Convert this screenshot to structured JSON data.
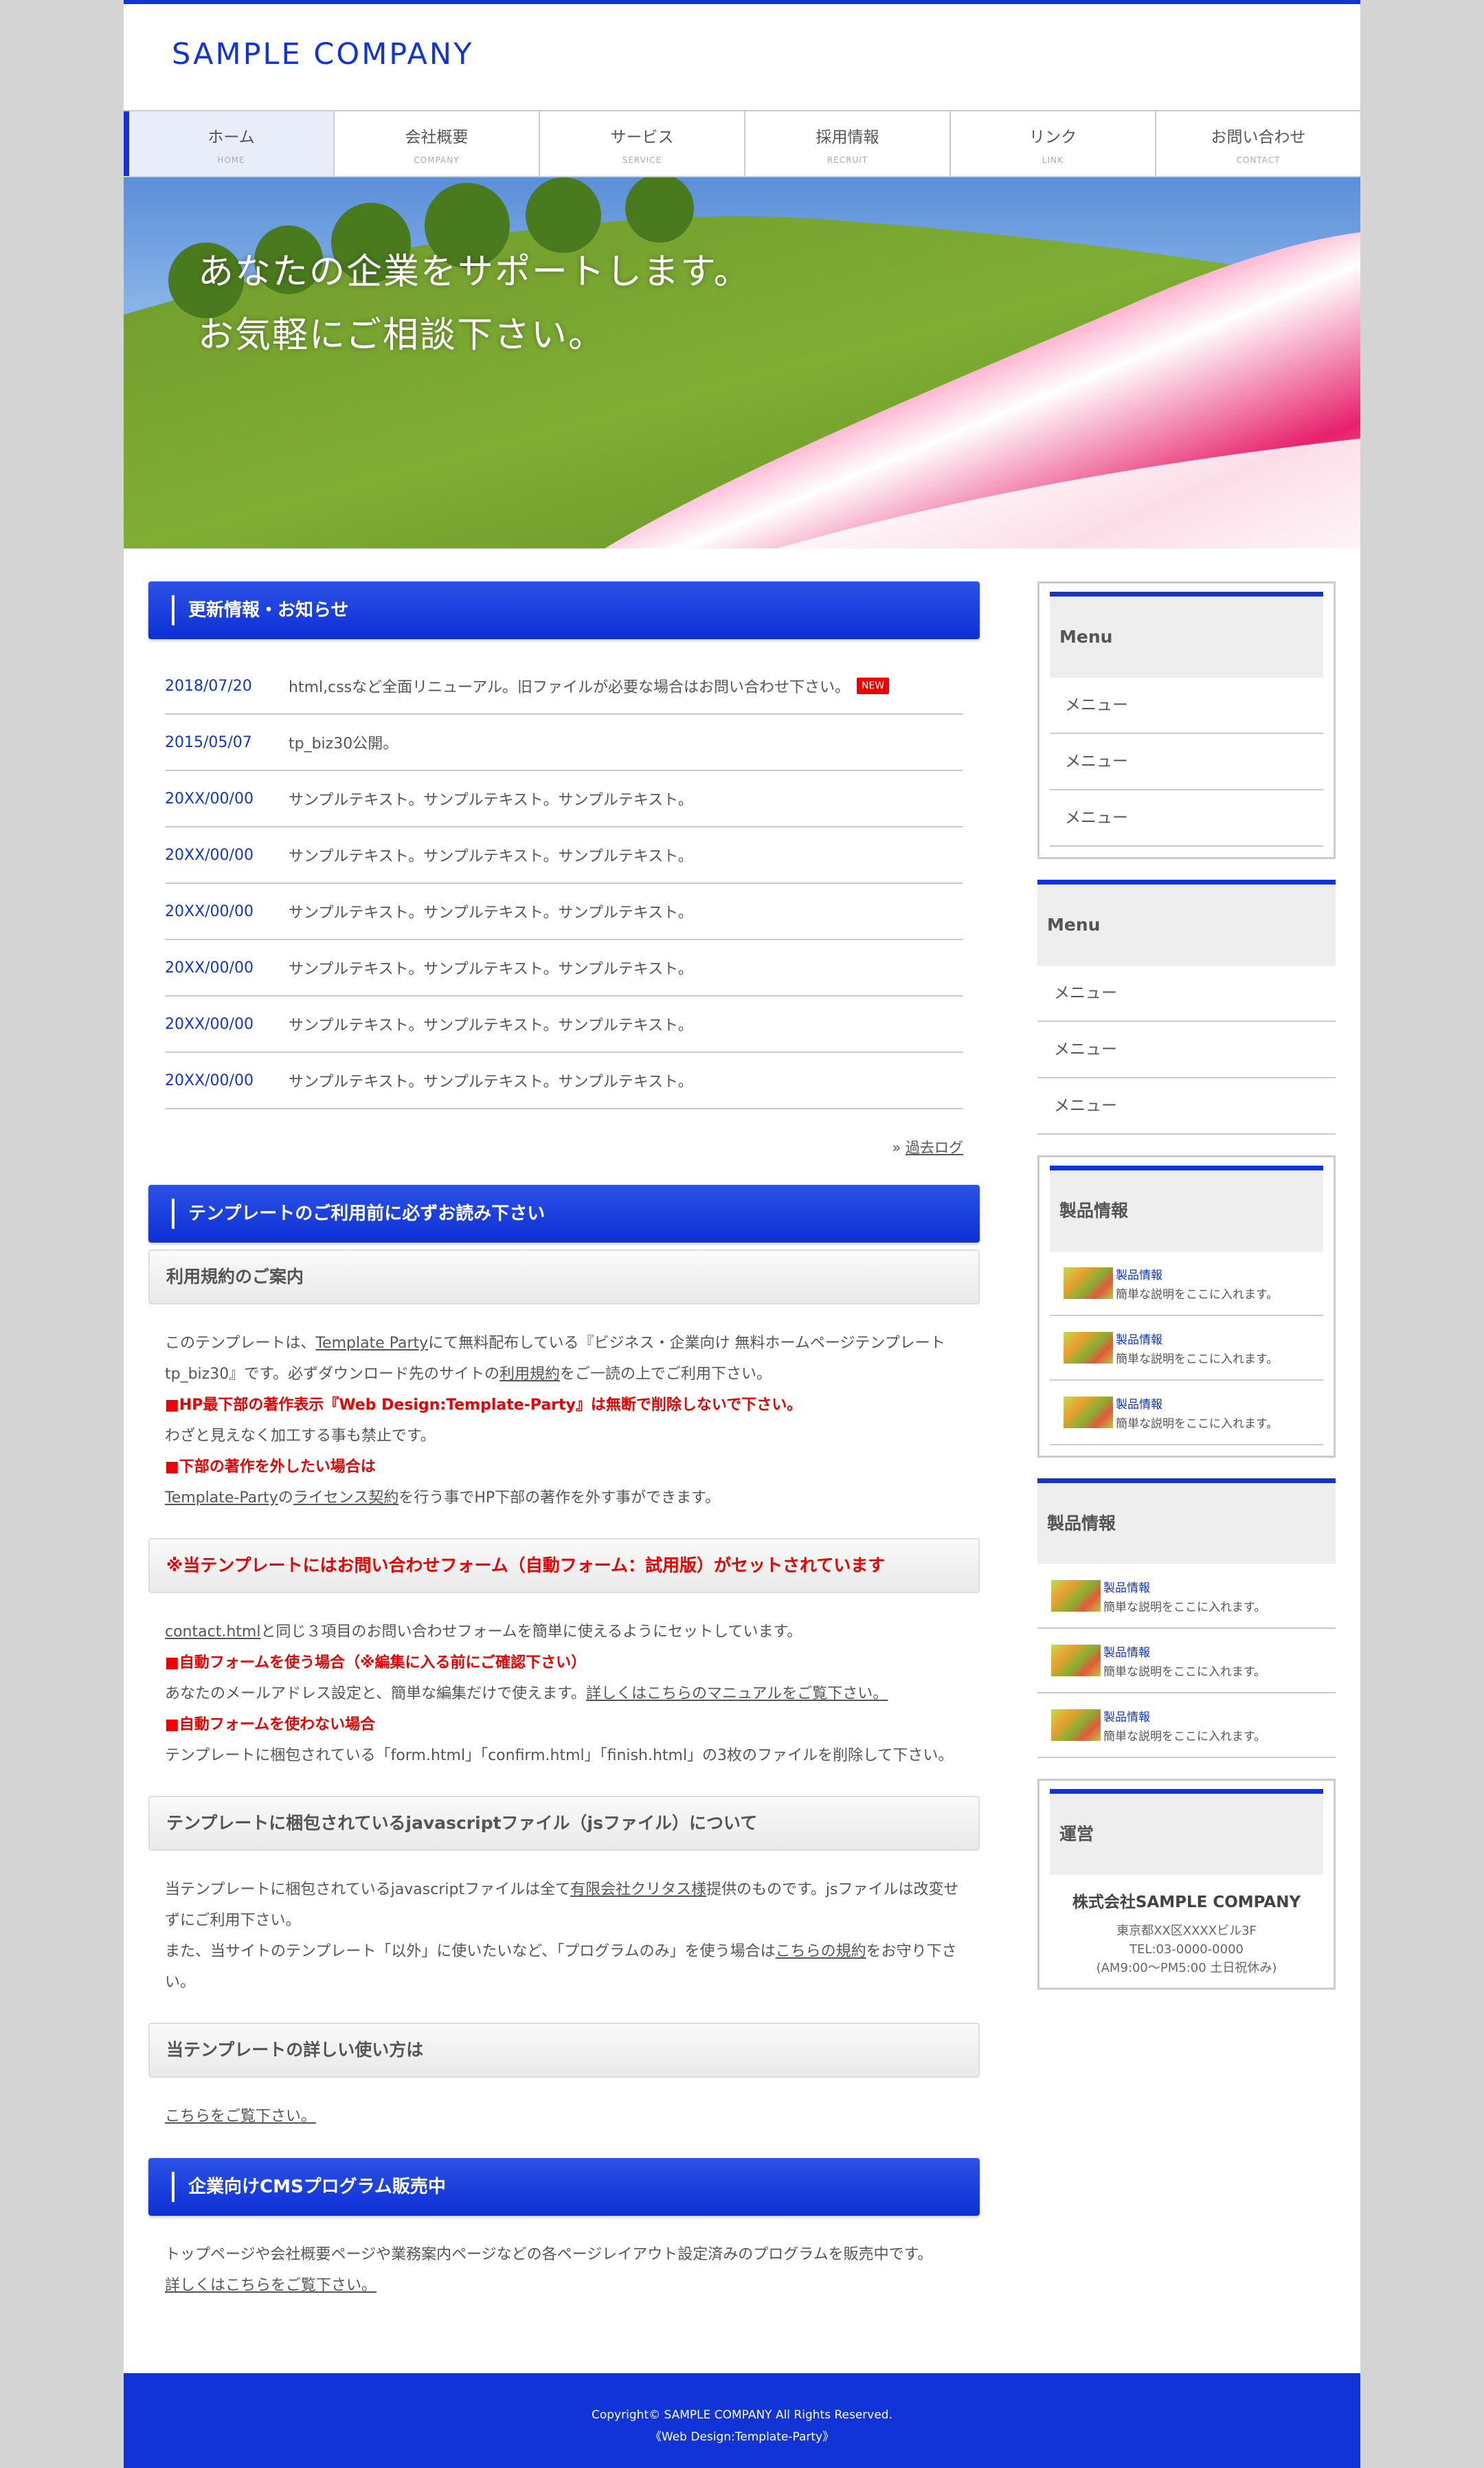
{
  "header": {
    "logo": "SAMPLE COMPANY"
  },
  "nav": [
    {
      "label": "ホーム",
      "sub": "HOME"
    },
    {
      "label": "会社概要",
      "sub": "COMPANY"
    },
    {
      "label": "サービス",
      "sub": "SERVICE"
    },
    {
      "label": "採用情報",
      "sub": "RECRUIT"
    },
    {
      "label": "リンク",
      "sub": "LINK"
    },
    {
      "label": "お問い合わせ",
      "sub": "CONTACT"
    }
  ],
  "hero": {
    "line1": "あなたの企業をサポートします。",
    "line2": "お気軽にご相談下さい。"
  },
  "news": {
    "heading": "更新情報・お知らせ",
    "new_badge": "NEW",
    "items": [
      {
        "date": "2018/07/20",
        "text": "html,cssなど全面リニューアル。旧ファイルが必要な場合はお問い合わせ下さい。"
      },
      {
        "date": "2015/05/07",
        "text": "tp_biz30公開。"
      },
      {
        "date": "20XX/00/00",
        "text": "サンプルテキスト。サンプルテキスト。サンプルテキスト。"
      },
      {
        "date": "20XX/00/00",
        "text": "サンプルテキスト。サンプルテキスト。サンプルテキスト。"
      },
      {
        "date": "20XX/00/00",
        "text": "サンプルテキスト。サンプルテキスト。サンプルテキスト。"
      },
      {
        "date": "20XX/00/00",
        "text": "サンプルテキスト。サンプルテキスト。サンプルテキスト。"
      },
      {
        "date": "20XX/00/00",
        "text": "サンプルテキスト。サンプルテキスト。サンプルテキスト。"
      },
      {
        "date": "20XX/00/00",
        "text": "サンプルテキスト。サンプルテキスト。サンプルテキスト。"
      }
    ],
    "past_log_prefix": "» ",
    "past_log": "過去ログ"
  },
  "template": {
    "heading": "テンプレートのご利用前に必ずお読み下さい",
    "terms_heading": "利用規約のご案内",
    "terms": {
      "p1_a": "このテンプレートは、",
      "p1_link": "Template Party",
      "p1_b": "にて無料配布している『ビジネス・企業向け 無料ホームページテンプレート tp_biz30』です。必ずダウンロード先のサイトの",
      "p1_link2": "利用規約",
      "p1_c": "をご一読の上でご利用下さい。",
      "red1": "■HP最下部の著作表示『Web Design:Template-Party』は無断で削除しないで下さい。",
      "p2": "わざと見えなく加工する事も禁止です。",
      "red2": "■下部の著作を外したい場合は",
      "p3_link": "Template-Party",
      "p3_a": "の",
      "p3_link2": "ライセンス契約",
      "p3_b": "を行う事でHP下部の著作を外す事ができます。"
    },
    "form_heading": "※当テンプレートにはお問い合わせフォーム（自動フォーム：試用版）がセットされています",
    "form": {
      "p1_link": "contact.html",
      "p1_a": "と同じ３項目のお問い合わせフォームを簡単に使えるようにセットしています。",
      "red1": "■自動フォームを使う場合（※編集に入る前にご確認下さい）",
      "p2_a": "あなたのメールアドレス設定と、簡単な編集だけで使えます。",
      "p2_link": "詳しくはこちらのマニュアルをご覧下さい。",
      "red2": "■自動フォームを使わない場合",
      "p3": "テンプレートに梱包されている「form.html」「confirm.html」「finish.html」の3枚のファイルを削除して下さい。"
    },
    "js_heading": "テンプレートに梱包されているjavascriptファイル（jsファイル）について",
    "js": {
      "p1_a": "当テンプレートに梱包されているjavascriptファイルは全て",
      "p1_link": "有限会社クリタス様",
      "p1_b": "提供のものです。jsファイルは改変せずにご利用下さい。",
      "p2_a": "また、当サイトのテンプレート「以外」に使いたいなど、「プログラムのみ」を使う場合は",
      "p2_link": "こちらの規約",
      "p2_b": "をお守り下さい。"
    },
    "usage_heading": "当テンプレートの詳しい使い方は",
    "usage_link": "こちらをご覧下さい。"
  },
  "cms": {
    "heading": "企業向けCMSプログラム販売中",
    "p1": "トップページや会社概要ページや業務案内ページなどの各ページレイアウト設定済みのプログラムを販売中です。",
    "link": "詳しくはこちらをご覧下さい。"
  },
  "sidebar": {
    "menu1": {
      "title": "Menu",
      "items": [
        "メニュー",
        "メニュー",
        "メニュー"
      ]
    },
    "menu2": {
      "title": "Menu",
      "items": [
        "メニュー",
        "メニュー",
        "メニュー"
      ]
    },
    "products1": {
      "title": "製品情報",
      "items": [
        {
          "title": "製品情報",
          "desc": "簡単な説明をここに入れます。"
        },
        {
          "title": "製品情報",
          "desc": "簡単な説明をここに入れます。"
        },
        {
          "title": "製品情報",
          "desc": "簡単な説明をここに入れます。"
        }
      ]
    },
    "products2": {
      "title": "製品情報",
      "items": [
        {
          "title": "製品情報",
          "desc": "簡単な説明をここに入れます。"
        },
        {
          "title": "製品情報",
          "desc": "簡単な説明をここに入れます。"
        },
        {
          "title": "製品情報",
          "desc": "簡単な説明をここに入れます。"
        }
      ]
    },
    "operator": {
      "title": "運営",
      "name": "株式会社SAMPLE COMPANY",
      "address": "東京都XX区XXXXビル3F",
      "tel": "TEL:03-0000-0000",
      "hours": "(AM9:00～PM5:00 土日祝休み)"
    }
  },
  "footer": {
    "copyright": "Copyright© SAMPLE COMPANY All Rights Reserved.",
    "credit": "《Web Design:Template-Party》"
  },
  "colors": {
    "accent": "#1034d8",
    "red": "#ee0000"
  }
}
